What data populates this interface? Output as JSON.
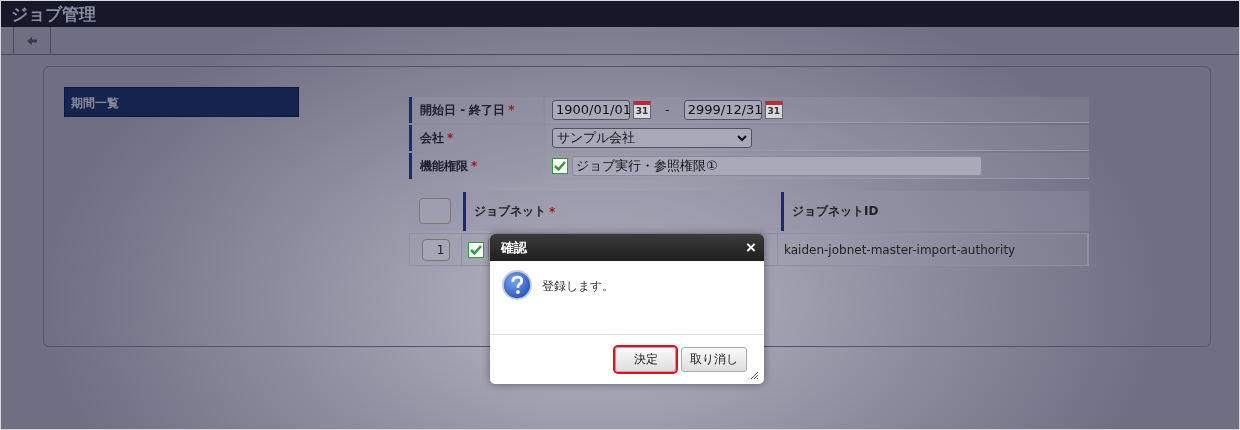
{
  "header": {
    "title": "ジョブ管理"
  },
  "toolbar": {
    "back_button": true
  },
  "sidebar": {
    "items": [
      {
        "label": "期間一覧",
        "selected": true
      }
    ]
  },
  "form": {
    "rows": [
      {
        "kind": "daterange",
        "label": "開始日 - 終了日",
        "required_mark": "*",
        "start": "1900/01/01",
        "start_calendar_day": "31",
        "separator": "-",
        "end": "2999/12/31",
        "end_calendar_day": "31"
      },
      {
        "kind": "select",
        "label": "会社",
        "required_mark": "*",
        "value": "サンプル会社"
      },
      {
        "kind": "checkbox",
        "label": "機能権限",
        "required_mark": "*",
        "checked": true,
        "value": "ジョブ実行・参照権限①"
      }
    ]
  },
  "table": {
    "columns": [
      {
        "label": "ジョブネット",
        "required_mark": "*"
      },
      {
        "label": "ジョブネットID"
      }
    ],
    "rows": [
      {
        "number": "1",
        "checked": true,
        "jobnet_id": "kaiden-jobnet-master-import-authority"
      }
    ]
  },
  "dialog": {
    "title": "確認",
    "close": "×",
    "message": "登録します。",
    "buttons": [
      {
        "label": "決定",
        "highlighted": true
      },
      {
        "label": "取り消し",
        "highlighted": false
      }
    ]
  }
}
